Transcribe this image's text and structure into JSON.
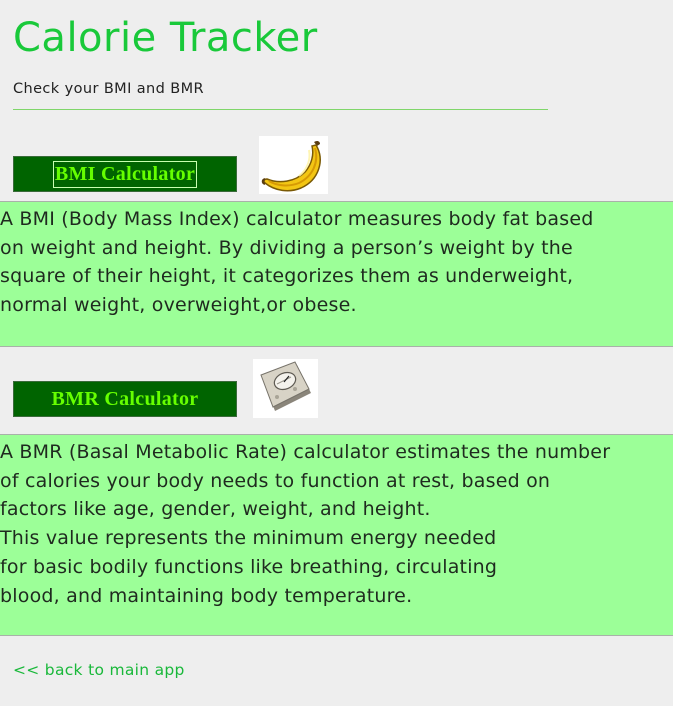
{
  "header": {
    "title": "Calorie Tracker",
    "subtitle": "Check your BMI and BMR"
  },
  "bmi": {
    "button_label": "BMI Calculator",
    "image_icon": "banana-icon",
    "description_lines": [
      "A BMI (Body Mass Index) calculator measures body fat based",
      "on weight and height. By dividing a person’s weight by the",
      "square of their height, it categorizes them as underweight,",
      "normal weight, overweight,or obese."
    ]
  },
  "bmr": {
    "button_label": "BMR Calculator",
    "image_icon": "bathroom-scale-icon",
    "description_lines": [
      "A BMR (Basal Metabolic Rate) calculator estimates the number",
      "of calories your body needs to function at rest, based on",
      "factors like age, gender, weight, and height.",
      "This value represents the minimum energy needed",
      "for basic bodily functions like breathing, circulating",
      "blood, and maintaining body temperature."
    ]
  },
  "footer": {
    "back_link": "<< back to main app"
  },
  "colors": {
    "title": "#19c93a",
    "button_bg": "#006400",
    "button_text": "#66ff00",
    "panel_bg": "#9cff98",
    "page_bg": "#eeeeee",
    "link": "#19b83a"
  }
}
